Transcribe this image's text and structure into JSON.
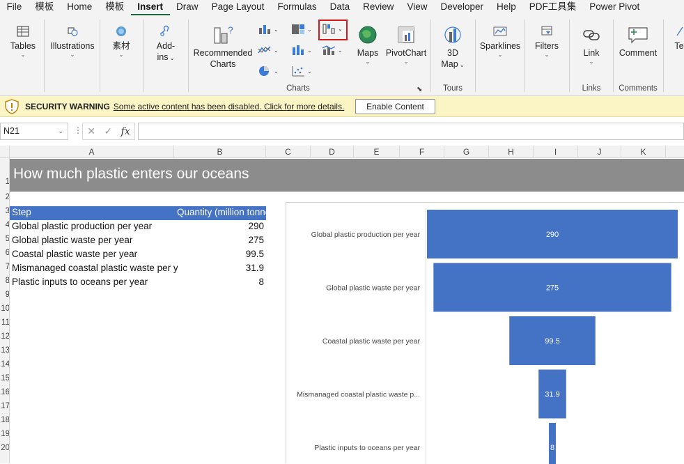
{
  "menu": [
    "File",
    "模板",
    "Home",
    "模板",
    "Insert",
    "Draw",
    "Page Layout",
    "Formulas",
    "Data",
    "Review",
    "View",
    "Developer",
    "Help",
    "PDF工具集",
    "Power Pivot"
  ],
  "active_menu": "Insert",
  "ribbon": {
    "tables": "Tables",
    "illustrations": "Illustrations",
    "sucai": "素材",
    "addins_1": "Add-",
    "addins_2": "ins",
    "recommended_1": "Recommended",
    "recommended_2": "Charts",
    "maps": "Maps",
    "pivotchart": "PivotChart",
    "map3d_1": "3D",
    "map3d_2": "Map",
    "sparklines": "Sparklines",
    "filters": "Filters",
    "link": "Link",
    "comment": "Comment",
    "text_cut": "Te",
    "group_charts": "Charts",
    "group_tours": "Tours",
    "group_links": "Links",
    "group_comments": "Comments"
  },
  "security": {
    "title": "SECURITY WARNING",
    "message": "Some active content has been disabled. Click for more details.",
    "button": "Enable Content"
  },
  "formula_bar": {
    "name_box": "N21",
    "fx": "fx",
    "content": ""
  },
  "columns": [
    "A",
    "B",
    "C",
    "D",
    "E",
    "F",
    "G",
    "H",
    "I",
    "J",
    "K"
  ],
  "rows": [
    "1",
    "2",
    "3",
    "4",
    "5",
    "6",
    "7",
    "8",
    "9",
    "10",
    "11",
    "12",
    "13",
    "14",
    "15",
    "16",
    "17",
    "18",
    "19",
    "20"
  ],
  "sheet": {
    "title": "How much plastic enters our oceans",
    "header_step": "Step",
    "header_quantity": "Quantity (million tonnes)",
    "rows": [
      {
        "step": "Global plastic production per year",
        "qty": "290"
      },
      {
        "step": "Global plastic waste per year",
        "qty": "275"
      },
      {
        "step": "Coastal plastic waste per year",
        "qty": "99.5"
      },
      {
        "step": "Mismanaged coastal plastic waste per year",
        "qty": "31.9"
      },
      {
        "step": "Plastic inputs to oceans per year",
        "qty": "8"
      }
    ]
  },
  "chart_data": {
    "type": "bar",
    "subtype": "funnel",
    "categories": [
      "Global plastic production per year",
      "Global plastic waste per year",
      "Coastal plastic waste per year",
      "Mismanaged coastal plastic waste p...",
      "Plastic inputs to oceans per year"
    ],
    "values": [
      290,
      275,
      99.5,
      31.9,
      8
    ],
    "data_labels": [
      "290",
      "275",
      "99.5",
      "31.9",
      "8"
    ],
    "bar_color": "#4472c4",
    "label_color": "#ffffff"
  },
  "colors": {
    "accent": "#1d6b3c",
    "highlight": "#d4191c",
    "warning_bg": "#fbf4c4",
    "title_band": "#8c8c8c",
    "table_header": "#4472c4"
  }
}
